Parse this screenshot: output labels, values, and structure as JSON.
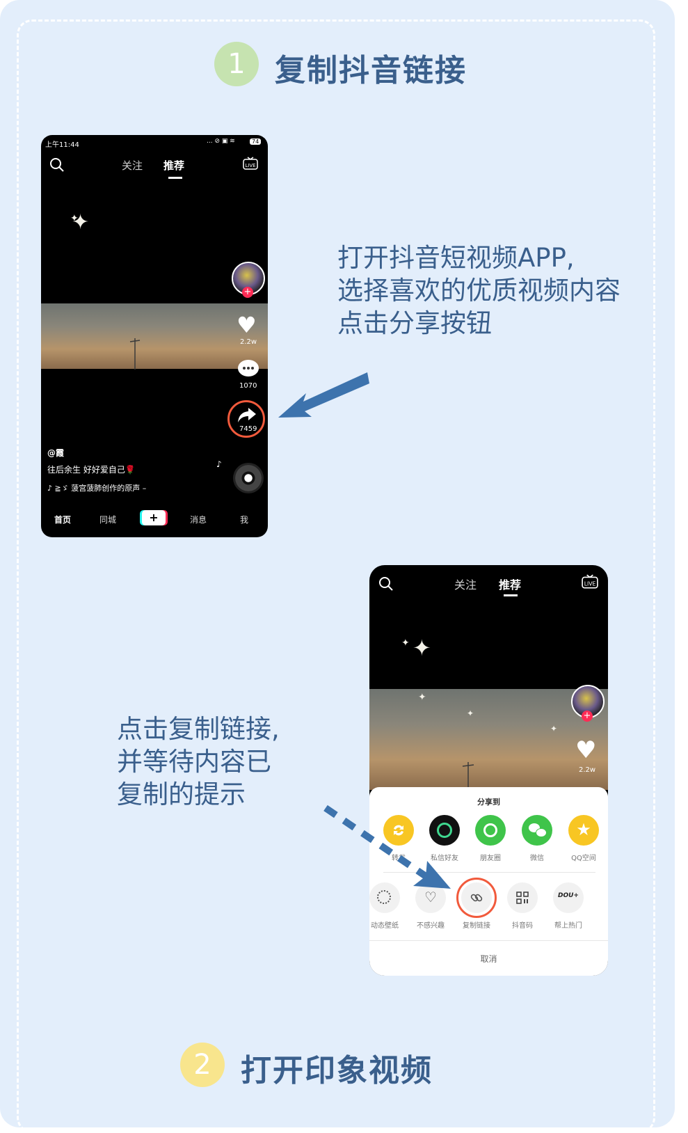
{
  "step1": {
    "number": "1",
    "title": "复制抖音链接",
    "color": "#c6e3b0"
  },
  "step2": {
    "number": "2",
    "title": "打开印象视频",
    "color": "#f8e58d"
  },
  "desc1": {
    "lines": [
      "打开抖音短视频APP,",
      "选择喜欢的优质视频内容",
      "点击分享按钮"
    ]
  },
  "desc2": {
    "lines": [
      "点击复制链接,",
      "并等待内容已",
      "复制的提示"
    ]
  },
  "phone1": {
    "status_time": "上午11:44",
    "status_right": "... ⊘ ▣ ≋",
    "battery": "74",
    "tab_follow": "关注",
    "tab_recommend": "推荐",
    "likes": "2.2w",
    "comments": "1070",
    "shares": "7459",
    "author": "@霞",
    "caption": "往后余生  好好爱自己🌹",
    "music": "♪ ≧ゞ 菠宫菠肺创作的原声 – ",
    "nav": [
      "首页",
      "同城",
      "+",
      "消息",
      "我"
    ],
    "icons": [
      "search-icon",
      "live-icon",
      "heart-icon",
      "comment-icon",
      "share-icon",
      "music-note-icon",
      "music-disc-icon"
    ]
  },
  "phone2": {
    "tab_follow": "关注",
    "tab_recommend": "推荐",
    "likes": "2.2w",
    "share_title": "分享到",
    "share_row1": [
      {
        "label": "转发",
        "color": "#f8c623"
      },
      {
        "label": "私信好友",
        "color": "#111111"
      },
      {
        "label": "朋友圈",
        "color": "#3fc44a"
      },
      {
        "label": "微信",
        "color": "#3fc44a"
      },
      {
        "label": "QQ空间",
        "color": "#f8c623"
      }
    ],
    "share_row2": [
      {
        "label": "动态壁纸"
      },
      {
        "label": "不感兴趣"
      },
      {
        "label": "复制链接"
      },
      {
        "label": "抖音码"
      },
      {
        "label": "帮上热门",
        "icon_text": "DOU+"
      }
    ],
    "cancel": "取消"
  },
  "colors": {
    "accent_ring": "#f15a3c",
    "arrow": "#3d73ad",
    "text": "#3a5f8c",
    "background": "#e3eefb"
  }
}
